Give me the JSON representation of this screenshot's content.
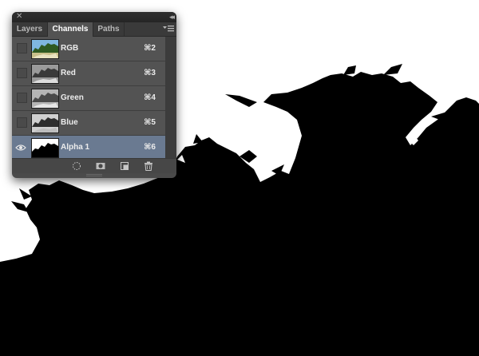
{
  "panel": {
    "tabs": [
      {
        "label": "Layers",
        "active": false
      },
      {
        "label": "Channels",
        "active": true
      },
      {
        "label": "Paths",
        "active": false
      }
    ],
    "channels": [
      {
        "label": "RGB",
        "shortcut": "⌘2",
        "visible": false,
        "selected": false,
        "thumb": "rgb"
      },
      {
        "label": "Red",
        "shortcut": "⌘3",
        "visible": false,
        "selected": false,
        "thumb": "gray"
      },
      {
        "label": "Green",
        "shortcut": "⌘4",
        "visible": false,
        "selected": false,
        "thumb": "gray"
      },
      {
        "label": "Blue",
        "shortcut": "⌘5",
        "visible": false,
        "selected": false,
        "thumb": "gray"
      },
      {
        "label": "Alpha 1",
        "shortcut": "⌘6",
        "visible": true,
        "selected": true,
        "thumb": "alpha"
      }
    ],
    "bottom_actions": [
      "load-selection-icon",
      "save-selection-icon",
      "new-channel-icon",
      "delete-channel-icon"
    ]
  },
  "colors": {
    "selected_row": "#6a7a91",
    "panel_bg": "#535353",
    "canvas_black": "#000000",
    "canvas_white": "#ffffff"
  }
}
